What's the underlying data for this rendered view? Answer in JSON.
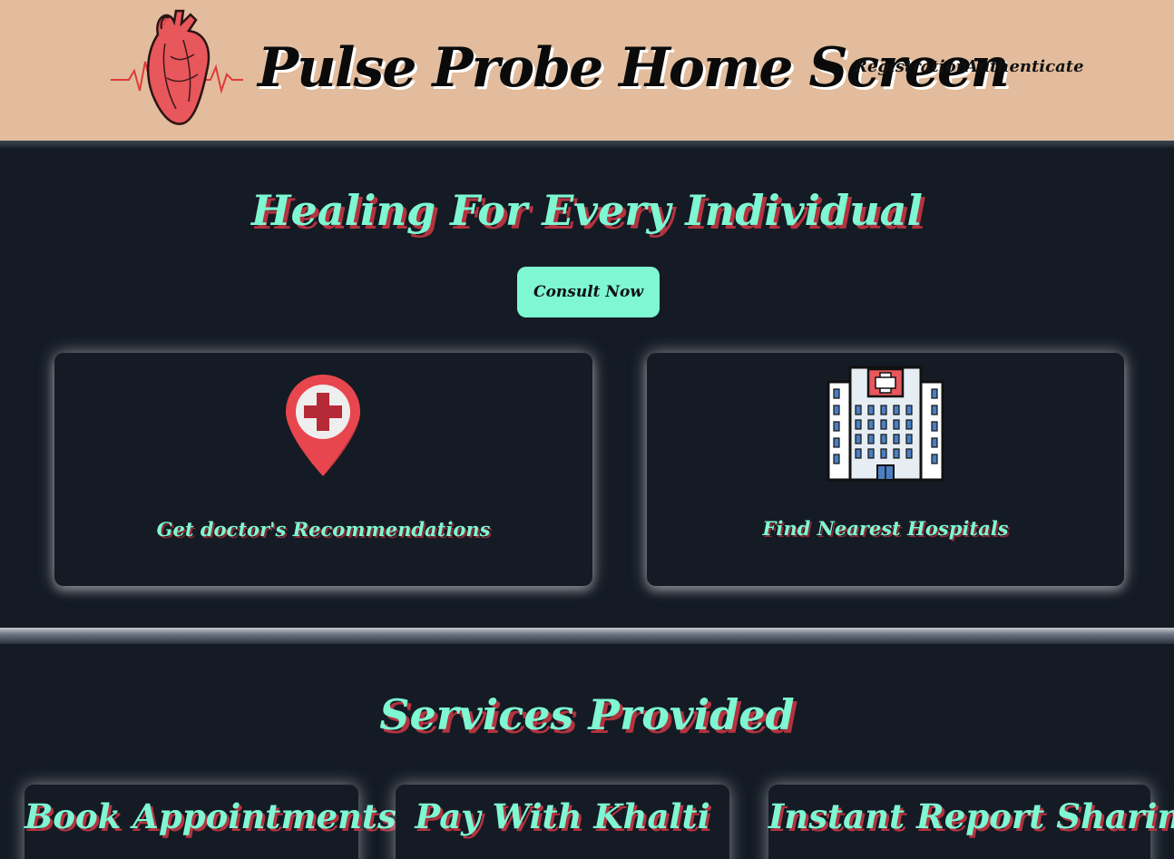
{
  "header": {
    "title": "Pulse Probe Home Screen",
    "logo_icon": "anatomical-heart-icon",
    "nav": [
      {
        "label": "Registration"
      },
      {
        "label": "Authenticate"
      }
    ]
  },
  "hero": {
    "title": "Healing For Every Individual",
    "cta_label": "Consult Now"
  },
  "cards": [
    {
      "label": "Get doctor's Recommendations",
      "icon": "medical-location-pin-icon"
    },
    {
      "label": "Find Nearest Hospitals",
      "icon": "hospital-building-icon"
    }
  ],
  "services": {
    "title": "Services Provided",
    "items": [
      {
        "title": "Book Appointments"
      },
      {
        "title": "Pay With Khalti"
      },
      {
        "title": "Instant Report Sharing"
      }
    ]
  },
  "colors": {
    "header_bg": "#e2bc9c",
    "page_bg": "#141b24",
    "accent": "#7ef7d2",
    "shadow_red": "#b3333f"
  }
}
